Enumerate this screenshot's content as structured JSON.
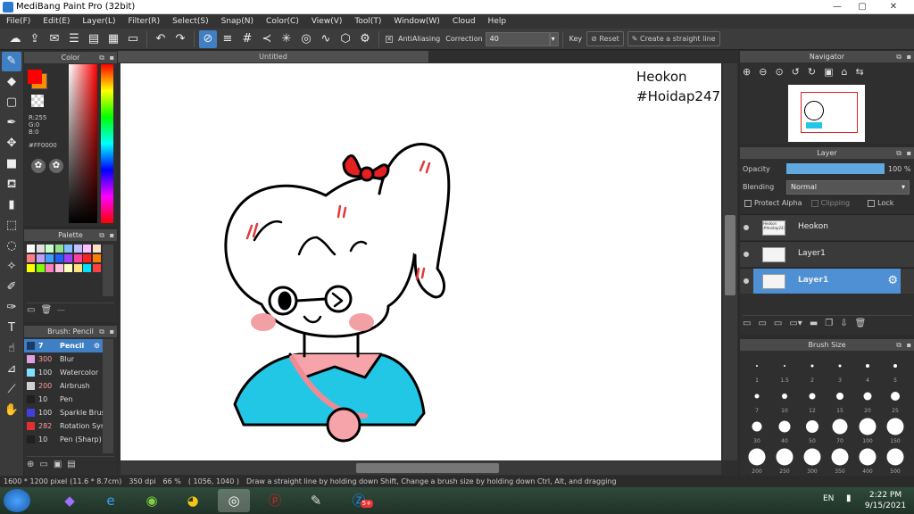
{
  "window": {
    "title": "MediBang Paint Pro (32bit)"
  },
  "menu": [
    "File(F)",
    "Edit(E)",
    "Layer(L)",
    "Filter(R)",
    "Select(S)",
    "Snap(N)",
    "Color(C)",
    "View(V)",
    "Tool(T)",
    "Window(W)",
    "Cloud",
    "Help"
  ],
  "toolbar": {
    "antialias": "AntiAliasing",
    "correction_label": "Correction",
    "correction_value": "40",
    "key_label": "Key",
    "reset_label": "Reset",
    "straight_label": "Create a straight line"
  },
  "color_panel": {
    "title": "Color",
    "r": "R:255",
    "g": "G:0",
    "b": "B:0",
    "hex": "#FF0000",
    "primary_color": "#FF0000",
    "secondary_color": "#FF8C00"
  },
  "palette_panel": {
    "title": "Palette",
    "extra": "---",
    "colors": [
      "#ffffff",
      "#e0e0e0",
      "#c8ffc8",
      "#90e090",
      "#80c0ff",
      "#c0c0ff",
      "#ffc0ff",
      "#ffe0c0",
      "#ff8080",
      "#c0a0ff",
      "#40a0ff",
      "#2060ff",
      "#a040ff",
      "#ff40a0",
      "#ff2020",
      "#ff8000",
      "#ffff00",
      "#80ff00",
      "#ff80c0",
      "#ffc0e0",
      "#ffffc0",
      "#ffe080",
      "#00e0ff",
      "#ff4040"
    ]
  },
  "brush_panel": {
    "title": "Brush: Pencil",
    "items": [
      {
        "size": "7",
        "name": "Pencil",
        "color": "#1a3a6a"
      },
      {
        "size": "300",
        "name": "Blur",
        "color": "#e0a0e0"
      },
      {
        "size": "100",
        "name": "Watercolor",
        "color": "#80e0ff"
      },
      {
        "size": "200",
        "name": "Airbrush",
        "color": "#d0d0d0"
      },
      {
        "size": "10",
        "name": "Pen",
        "color": "#202020"
      },
      {
        "size": "100",
        "name": "Sparkle Brush",
        "color": "#4040e0"
      },
      {
        "size": "282",
        "name": "Rotation Symmetry",
        "color": "#e03030"
      },
      {
        "size": "10",
        "name": "Pen (Sharp)",
        "color": "#202020"
      }
    ]
  },
  "document": {
    "tab": "Untitled",
    "watermark_line1": "Heokon",
    "watermark_line2": "#Hoidap247"
  },
  "navigator": {
    "title": "Navigator"
  },
  "layer_panel": {
    "title": "Layer",
    "opacity_label": "Opacity",
    "opacity_value": "100 %",
    "opacity_fraction": 1.0,
    "blending_label": "Blending",
    "blending_value": "Normal",
    "protect_alpha": "Protect Alpha",
    "clipping": "Clipping",
    "lock": "Lock",
    "layers": [
      {
        "name": "Heokon",
        "thumb_text": "Heokon #Hoidap247"
      },
      {
        "name": "Layer1",
        "thumb_text": ""
      },
      {
        "name": "Layer1",
        "thumb_text": ""
      }
    ]
  },
  "brush_size": {
    "title": "Brush Size",
    "sizes": [
      "1",
      "1.5",
      "2",
      "3",
      "4",
      "5",
      "7",
      "10",
      "12",
      "15",
      "20",
      "25",
      "30",
      "40",
      "50",
      "70",
      "100",
      "150",
      "200",
      "250",
      "300",
      "350",
      "400",
      "500"
    ]
  },
  "status": {
    "pixels": "1600 * 1200 pixel",
    "physical": "(11.6 * 8.7cm)",
    "dpi": "350 dpi",
    "zoom": "66 %",
    "coords": "( 1056, 1040 )",
    "hint": "Draw a straight line by holding down Shift, Change a brush size by holding down Ctrl, Alt, and dragging"
  },
  "taskbar": {
    "language": "EN",
    "time": "2:22 PM",
    "date": "9/15/2021",
    "zalo_badge": "5+"
  }
}
